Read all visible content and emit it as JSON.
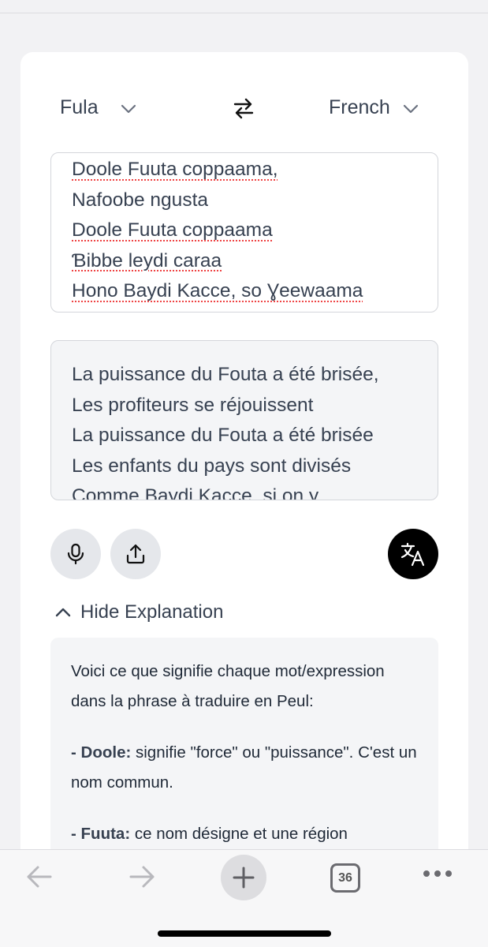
{
  "languages": {
    "source": "Fula",
    "target": "French",
    "swap_icon": "swap-arrows-icon"
  },
  "source_text": {
    "lines": [
      "Doole Fuuta coppaama,",
      "Nafoobe ngusta",
      "Doole Fuuta coppaama",
      "Ɓibbe leydi caraa",
      "Hono Baydi Kacce, so Ɣeewaama"
    ]
  },
  "translation": {
    "lines": [
      "La puissance du Fouta a été brisée,",
      "Les profiteurs se réjouissent",
      "La puissance du Fouta a été brisée",
      "Les enfants du pays sont divisés",
      "Comme Baydi Kacce, si on y"
    ]
  },
  "actions": {
    "mic_icon": "microphone-icon",
    "upload_icon": "upload-icon",
    "translate_icon": "translate-icon"
  },
  "explanation": {
    "toggle_label": "Hide Explanation",
    "intro": "Voici ce que signifie chaque mot/expression dans la phrase à traduire en Peul:",
    "item1_term": "- Doole:",
    "item1_text": " signifie \"force\" ou \"puissance\". C'est un nom commun.",
    "item2_term": "- Fuuta:",
    "item2_text": " ce nom désigne et une région"
  },
  "toolbar": {
    "tab_count": "36"
  },
  "colors": {
    "background": "#f2f2f4",
    "card": "#ffffff",
    "translate_button": "#000000",
    "spellcheck": "#ef4444"
  }
}
